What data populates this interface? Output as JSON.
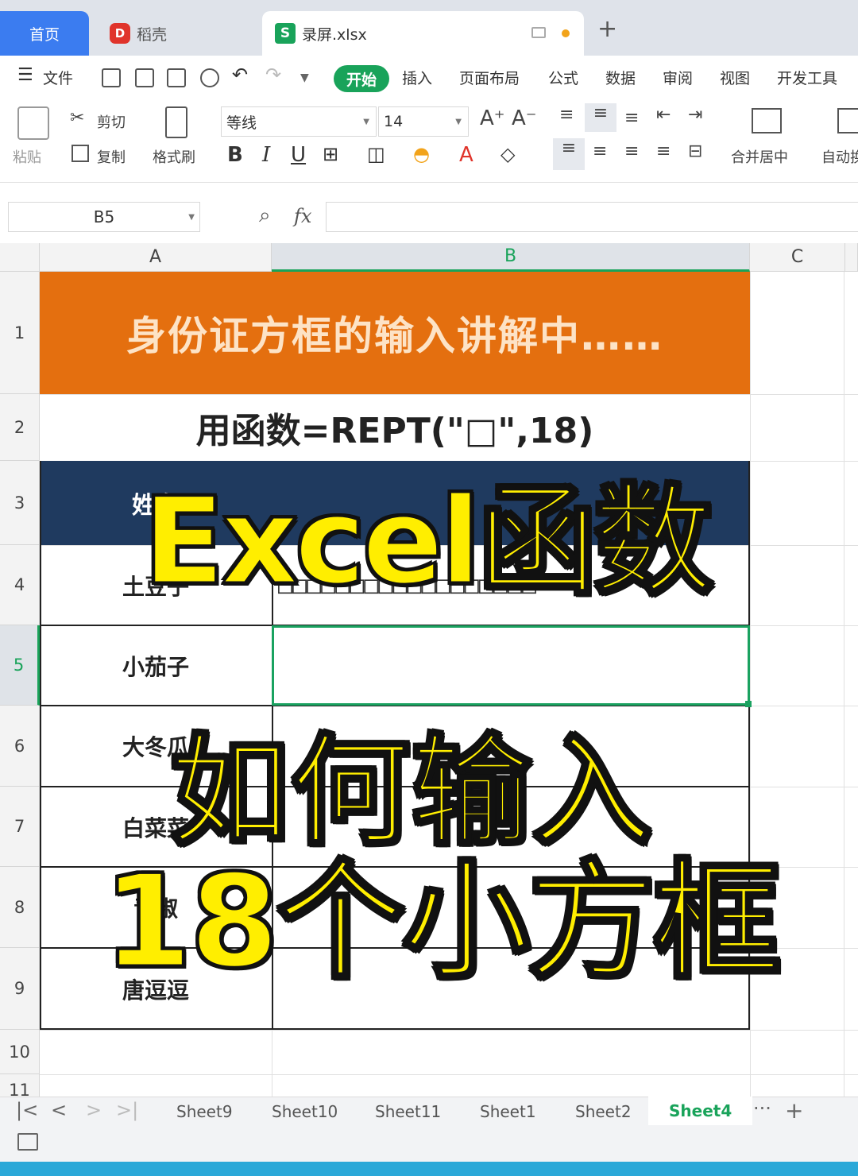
{
  "tabs": {
    "home": "首页",
    "daoke": "稻壳",
    "file": "录屏.xlsx",
    "daoke_logo": "D",
    "file_logo": "S",
    "new_tab": "+"
  },
  "menu": {
    "file": "文件",
    "items": [
      "开始",
      "插入",
      "页面布局",
      "公式",
      "数据",
      "审阅",
      "视图",
      "开发工具"
    ]
  },
  "ribbon": {
    "paste": "粘贴",
    "cut": "剪切",
    "copy": "复制",
    "format_painter": "格式刷",
    "font_name": "等线",
    "font_size": "14",
    "merge_center": "合并居中",
    "auto": "自动换"
  },
  "formula_bar": {
    "cell_ref": "B5",
    "fx": "fx",
    "value": ""
  },
  "columns": [
    "A",
    "B",
    "C"
  ],
  "rows": [
    "1",
    "2",
    "3",
    "4",
    "5",
    "6",
    "7",
    "8",
    "9",
    "10",
    "11"
  ],
  "sheet": {
    "title": "身份证方框的输入讲解中……",
    "formula_note": "用函数=REPT(\"□\",18)",
    "header_name": "姓名",
    "names": [
      "土豆子",
      "小茄子",
      "大冬瓜",
      "白菜菜",
      "青椒",
      "唐逗逗"
    ],
    "boxes_row4": "□□□□□□□□□□□□□□□□□□"
  },
  "overlay": {
    "line1": "Excel函数",
    "line2": "如何输入",
    "line3": "18个小方框"
  },
  "sheet_tabs": [
    "Sheet9",
    "Sheet10",
    "Sheet11",
    "Sheet1",
    "Sheet2",
    "Sheet4"
  ],
  "active_sheet": "Sheet4",
  "colors": {
    "title_fill": "#e46f0f",
    "header_fill": "#1f3a5f",
    "accent_green": "#19a35a",
    "overlay_text": "#ffee00"
  }
}
